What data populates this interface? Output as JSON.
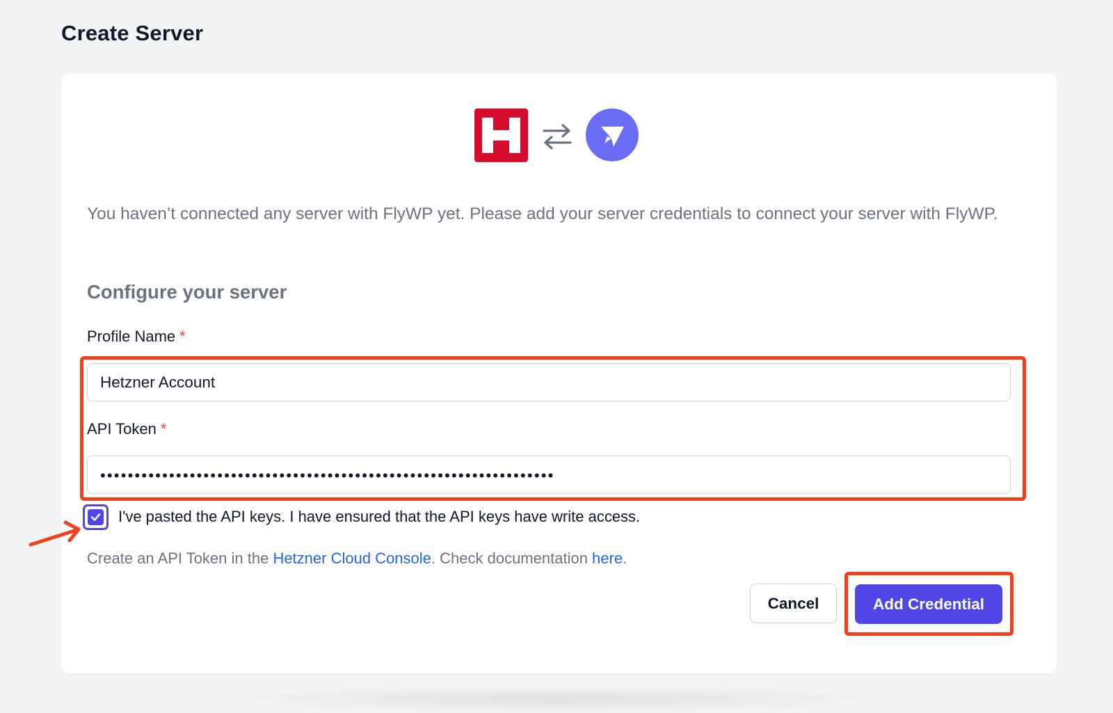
{
  "page": {
    "title": "Create Server"
  },
  "logos": {
    "provider_icon": "hetzner-h-logo",
    "swap_icon": "arrows-left-right-icon",
    "app_icon": "flywp-paper-plane-logo",
    "provider_color": "#d50c2d",
    "app_color": "#6b6cf6"
  },
  "intro": {
    "text": "You haven’t connected any server with FlyWP yet. Please add your server credentials to connect your server with FlyWP."
  },
  "configure": {
    "heading": "Configure your server"
  },
  "form": {
    "profile_label": "Profile Name",
    "profile_value": "Hetzner Account",
    "token_label": "API Token",
    "token_value": "••••••••••••••••••••••••••••••••••••••••••••••••••••••••••••••••••",
    "required_mark": "*",
    "confirm_checked": true,
    "confirm_label": "I've pasted the API keys. I have ensured that the API keys have write access."
  },
  "help": {
    "prefix": "Create an API Token in the ",
    "console_link": "Hetzner Cloud Console",
    "middle": ". Check documentation ",
    "docs_link": "here",
    "suffix": "."
  },
  "actions": {
    "cancel_label": "Cancel",
    "submit_label": "Add Credential"
  },
  "colors": {
    "accent": "#4f46e5",
    "highlight": "#f0411d",
    "link": "#2563eb",
    "muted_text": "#6b7280"
  }
}
